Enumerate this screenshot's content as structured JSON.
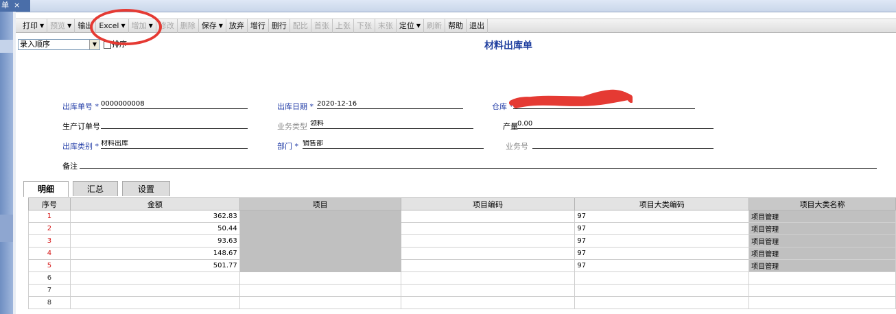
{
  "window": {
    "tab_label": "单",
    "close_glyph": "×"
  },
  "toolbar": {
    "items": [
      {
        "label": "打印",
        "dropdown": true,
        "enabled": true
      },
      {
        "label": "预览",
        "dropdown": true,
        "enabled": false
      },
      {
        "label": "输出",
        "dropdown": false,
        "enabled": true
      },
      {
        "label": "Excel",
        "dropdown": true,
        "enabled": true
      },
      {
        "label": "增加",
        "dropdown": true,
        "enabled": false
      },
      {
        "label": "修改",
        "dropdown": false,
        "enabled": false
      },
      {
        "label": "删除",
        "dropdown": false,
        "enabled": false
      },
      {
        "label": "保存",
        "dropdown": true,
        "enabled": true
      },
      {
        "label": "放弃",
        "dropdown": false,
        "enabled": true
      },
      {
        "label": "增行",
        "dropdown": false,
        "enabled": true
      },
      {
        "label": "删行",
        "dropdown": false,
        "enabled": true
      },
      {
        "label": "配比",
        "dropdown": false,
        "enabled": false
      },
      {
        "label": "首张",
        "dropdown": false,
        "enabled": false
      },
      {
        "label": "上张",
        "dropdown": false,
        "enabled": false
      },
      {
        "label": "下张",
        "dropdown": false,
        "enabled": false
      },
      {
        "label": "末张",
        "dropdown": false,
        "enabled": false
      },
      {
        "label": "定位",
        "dropdown": true,
        "enabled": true
      },
      {
        "label": "刷新",
        "dropdown": false,
        "enabled": false
      },
      {
        "label": "帮助",
        "dropdown": false,
        "enabled": true
      },
      {
        "label": "退出",
        "dropdown": false,
        "enabled": true
      }
    ]
  },
  "sort": {
    "selected": "录入顺序",
    "checkbox_label": "排序"
  },
  "form": {
    "title": "材料出库单",
    "required_mark": "*",
    "fields": {
      "out_no": {
        "label": "出库单号",
        "value": "0000000008"
      },
      "out_date": {
        "label": "出库日期",
        "value": "2020-12-16"
      },
      "warehouse": {
        "label": "仓库",
        "value": ""
      },
      "prod_order": {
        "label": "生产订单号",
        "value": ""
      },
      "biz_type": {
        "label": "业务类型",
        "value": "领料"
      },
      "output": {
        "label": "产量",
        "value": "0.00"
      },
      "out_type": {
        "label": "出库类别",
        "value": "材料出库"
      },
      "dept": {
        "label": "部门",
        "value": "销售部"
      },
      "biz_no": {
        "label": "业务号",
        "value": ""
      },
      "remark": {
        "label": "备注",
        "value": ""
      }
    }
  },
  "tabs": [
    {
      "label": "明细",
      "active": true
    },
    {
      "label": "汇总",
      "active": false
    },
    {
      "label": "设置",
      "active": false
    }
  ],
  "grid": {
    "columns": [
      "序号",
      "金额",
      "项目",
      "项目编码",
      "项目大类编码",
      "项目大类名称"
    ],
    "rows": [
      {
        "seq": "1",
        "amount": "362.83",
        "item": "",
        "item_code": "",
        "cat_code": "97",
        "cat_name": "项目管理"
      },
      {
        "seq": "2",
        "amount": "50.44",
        "item": "",
        "item_code": "",
        "cat_code": "97",
        "cat_name": "项目管理"
      },
      {
        "seq": "3",
        "amount": "93.63",
        "item": "",
        "item_code": "",
        "cat_code": "97",
        "cat_name": "项目管理"
      },
      {
        "seq": "4",
        "amount": "148.67",
        "item": "",
        "item_code": "",
        "cat_code": "97",
        "cat_name": "项目管理"
      },
      {
        "seq": "5",
        "amount": "501.77",
        "item": "",
        "item_code": "",
        "cat_code": "97",
        "cat_name": "项目管理"
      },
      {
        "seq": "6",
        "amount": "",
        "item": "",
        "item_code": "",
        "cat_code": "",
        "cat_name": ""
      },
      {
        "seq": "7",
        "amount": "",
        "item": "",
        "item_code": "",
        "cat_code": "",
        "cat_name": ""
      },
      {
        "seq": "8",
        "amount": "",
        "item": "",
        "item_code": "",
        "cat_code": "",
        "cat_name": ""
      }
    ]
  },
  "colors": {
    "title": "#1d3d9e",
    "required_label": "#1f3aa6",
    "row_number_red": "#d51010",
    "annotation_red": "#e53a33",
    "readonly_cell": "#c0c0c0"
  }
}
